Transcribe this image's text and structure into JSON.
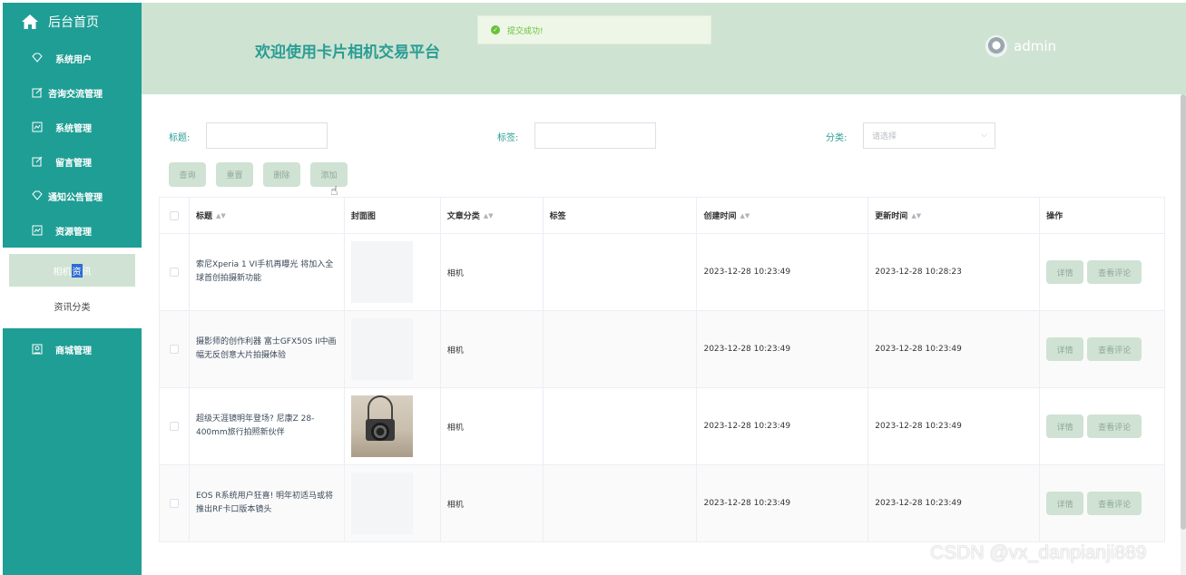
{
  "sidebar": {
    "home_label": "后台首页",
    "items": [
      {
        "label": "系统用户",
        "icon": "diamond-icon"
      },
      {
        "label": "咨询交流管理",
        "icon": "edit-icon"
      },
      {
        "label": "系统管理",
        "icon": "chart-icon"
      },
      {
        "label": "留言管理",
        "icon": "edit-icon"
      },
      {
        "label": "通知公告管理",
        "icon": "diamond-icon"
      },
      {
        "label": "资源管理",
        "icon": "chart-icon"
      }
    ],
    "submenu": {
      "active_label_pre": "相机",
      "active_label_hl": "资",
      "active_label_post": "讯",
      "second_label": "资讯分类"
    },
    "last_item": {
      "label": "商城管理",
      "icon": "store-icon"
    }
  },
  "header": {
    "title": "欢迎使用卡片相机交易平台",
    "username": "admin"
  },
  "toast": {
    "message": "提交成功!",
    "color": "#67c23a"
  },
  "filters": {
    "title_label": "标题:",
    "tag_label": "标签:",
    "category_label": "分类:",
    "category_placeholder": "请选择"
  },
  "buttons": {
    "query": "查询",
    "reset": "重置",
    "delete": "删除",
    "add": "添加"
  },
  "table": {
    "headers": {
      "title": "标题",
      "cover": "封面图",
      "category": "文章分类",
      "tags": "标签",
      "created": "创建时间",
      "updated": "更新时间",
      "actions": "操作"
    },
    "rows": [
      {
        "title": "索尼Xperia 1 VI手机再曝光 将加入全球首创拍摄新功能",
        "category": "相机",
        "tags": "",
        "created": "2023-12-28 10:23:49",
        "updated": "2023-12-28 10:28:23"
      },
      {
        "title": "摄影师的创作利器 富士GFX50S II中画幅无反创意大片拍摄体验",
        "category": "相机",
        "tags": "",
        "created": "2023-12-28 10:23:49",
        "updated": "2023-12-28 10:23:49"
      },
      {
        "title": "超级天涯镜明年登场? 尼康Z 28-400mm旅行拍照新伙伴",
        "category": "相机",
        "tags": "",
        "created": "2023-12-28 10:23:49",
        "updated": "2023-12-28 10:23:49"
      },
      {
        "title": "EOS R系统用户狂喜! 明年初适马或将推出RF卡口版本镜头",
        "category": "相机",
        "tags": "",
        "created": "2023-12-28 10:23:49",
        "updated": "2023-12-28 10:23:49"
      }
    ],
    "detail_label": "详情",
    "comment_label": "查看评论"
  },
  "watermark": "CSDN @vx_danpianji889",
  "colors": {
    "sidebar": "#1f9e95",
    "header": "#cfe3d2",
    "accent": "#2a9d94",
    "button": "#cfe2d3"
  }
}
